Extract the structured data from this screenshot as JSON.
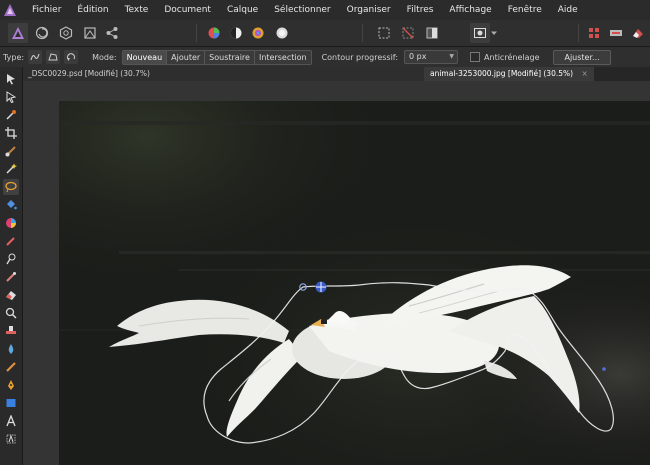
{
  "menu": {
    "items": [
      "Fichier",
      "Édition",
      "Texte",
      "Document",
      "Calque",
      "Sélectionner",
      "Organiser",
      "Filtres",
      "Affichage",
      "Fenêtre",
      "Aide"
    ]
  },
  "context_bar": {
    "type_label": "Type:",
    "mode_label": "Mode:",
    "modes": [
      "Nouveau",
      "Ajouter",
      "Soustraire",
      "Intersection"
    ],
    "selected_mode": "Nouveau",
    "feather_label": "Contour progressif:",
    "feather_value": "0 px",
    "antialias_label": "Anticrénelage",
    "antialias_checked": false,
    "adjust_button": "Ajuster..."
  },
  "tabs": [
    {
      "label": "_DSC0029.psd [Modifié] (30.7%)",
      "active": false
    },
    {
      "label": "animal-3253000.jpg [Modifié] (30.5%)",
      "active": true
    }
  ],
  "tools": [
    "move-tool",
    "node-tool",
    "eyedropper-tool",
    "crop-tool",
    "paintbrush-tool",
    "magic-selection-tool",
    "freehand-selection-tool",
    "flood-fill-tool",
    "color-picker-tool",
    "pen-paint-tool",
    "dodge-tool",
    "smudge-tool",
    "eraser-tool",
    "zoom-tool",
    "stamp-tool",
    "blur-tool",
    "gradient-tool",
    "vector-pen-tool",
    "rectangle-tool",
    "text-tool",
    "artistic-text-tool"
  ],
  "colors": {
    "accent": "#c8a2d8",
    "selection_outline": "#f2f2f2",
    "photo_background": "#1b1d1a"
  }
}
